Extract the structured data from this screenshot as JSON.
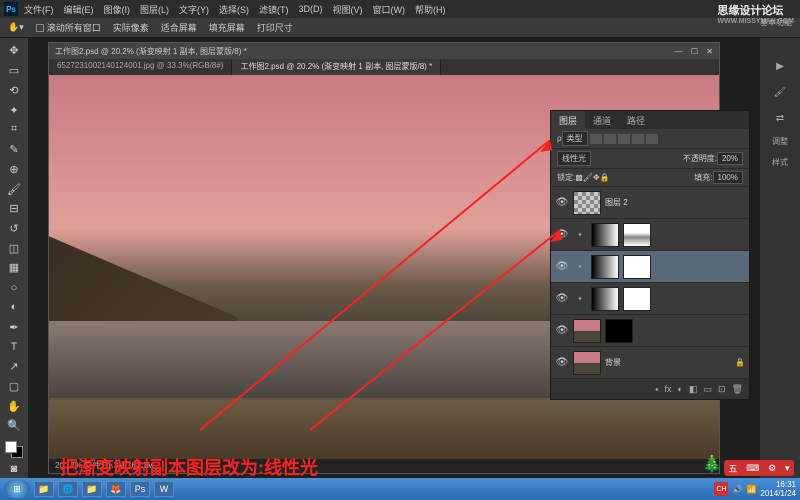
{
  "watermark": {
    "title": "思缘设计论坛",
    "url": "WWW.MISSYUAN.COM"
  },
  "func_label": "基本功能",
  "menubar": {
    "items": [
      "文件(F)",
      "编辑(E)",
      "图像(I)",
      "图层(L)",
      "文字(Y)",
      "选择(S)",
      "滤镜(T)",
      "3D(D)",
      "视图(V)",
      "窗口(W)",
      "帮助(H)"
    ]
  },
  "optionsbar": {
    "scroll_all": "滚动所有窗口",
    "actual": "实际像素",
    "fit": "适合屏幕",
    "fill": "填充屏幕",
    "print_size": "打印尺寸"
  },
  "doc": {
    "title": "工作图2.psd @ 20.2% (渐变映射 1 副本, 图层蒙版/8) *",
    "tabs": [
      "6527231002140124001.jpg @ 33.3%(RGB/8#)",
      "工作图2.psd @ 20.2% (渐变映射 1 副本, 图层蒙版/8) *"
    ],
    "status": "20.17%    文件:51.3M/161.1M"
  },
  "right_panel": {
    "icons": [
      "▶",
      "🖌",
      "⇄"
    ],
    "labels": [
      "调整",
      "样式"
    ]
  },
  "layers": {
    "tabs": [
      "图层",
      "通道",
      "路径"
    ],
    "type_label": "类型",
    "blend_mode": "线性光",
    "opacity_label": "不透明度:",
    "opacity_value": "20%",
    "lock_label": "锁定:",
    "fill_label": "填充:",
    "fill_value": "100%",
    "items": [
      {
        "name": "图层 2",
        "thumb": "trans",
        "eye": true
      },
      {
        "name": "",
        "thumb": "grad",
        "mask": "cloud",
        "eye": true,
        "link": true
      },
      {
        "name": "",
        "thumb": "grad",
        "mask": "white",
        "eye": true,
        "link": true,
        "selected": true
      },
      {
        "name": "",
        "thumb": "grad",
        "mask": "white",
        "eye": true,
        "link": true
      },
      {
        "name": "",
        "thumb": "photo",
        "mask": "mask",
        "eye": true
      },
      {
        "name": "背景",
        "thumb": "photo",
        "eye": true,
        "lock": true
      }
    ],
    "footer_icons": [
      "fx",
      "◐",
      "◧",
      "▭",
      "⊡",
      "🗑"
    ]
  },
  "annotation": "把渐变映射副本图层改为:线性光",
  "taskbar": {
    "apps": [
      "📁",
      "🌐",
      "📁",
      "🦊",
      "Ps",
      "W"
    ],
    "tray": {
      "ch": "CH",
      "wu": "五",
      "icons": [
        "🔊",
        "🔗",
        "📶"
      ],
      "time": "16:31",
      "date": "2014/1/24"
    }
  }
}
